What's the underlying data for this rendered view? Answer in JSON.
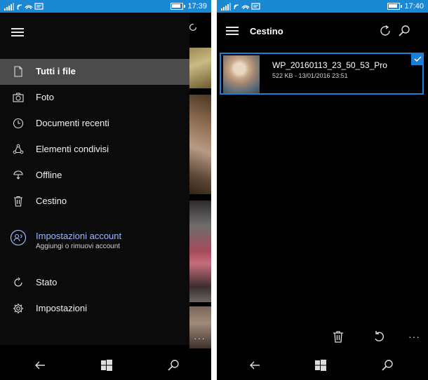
{
  "left_phone": {
    "status": {
      "time": "17:39"
    },
    "drawer": {
      "items": [
        {
          "label": "Tutti i file",
          "icon": "file-icon",
          "active": true
        },
        {
          "label": "Foto",
          "icon": "camera-icon"
        },
        {
          "label": "Documenti recenti",
          "icon": "clock-icon"
        },
        {
          "label": "Elementi condivisi",
          "icon": "share-icon"
        },
        {
          "label": "Offline",
          "icon": "offline-icon"
        },
        {
          "label": "Cestino",
          "icon": "trash-icon"
        }
      ],
      "account": {
        "title": "Impostazioni account",
        "subtitle": "Aggiungi o rimuovi account",
        "icon": "account-icon"
      },
      "bottom_items": [
        {
          "label": "Stato",
          "icon": "sync-icon"
        },
        {
          "label": "Impostazioni",
          "icon": "gear-icon"
        }
      ]
    },
    "overflow_dots": "···"
  },
  "right_phone": {
    "status": {
      "time": "17:40"
    },
    "header": {
      "title": "Cestino"
    },
    "file": {
      "name": "WP_20160113_23_50_53_Pro",
      "meta": "522 KB - 13/01/2016 23:51",
      "selected": true
    },
    "overflow_dots": "···"
  },
  "colors": {
    "status_bar": "#1b88d4",
    "accent": "#1b7fd6",
    "active_item": "#4b4b4b",
    "account_text": "#9fb8ff"
  }
}
